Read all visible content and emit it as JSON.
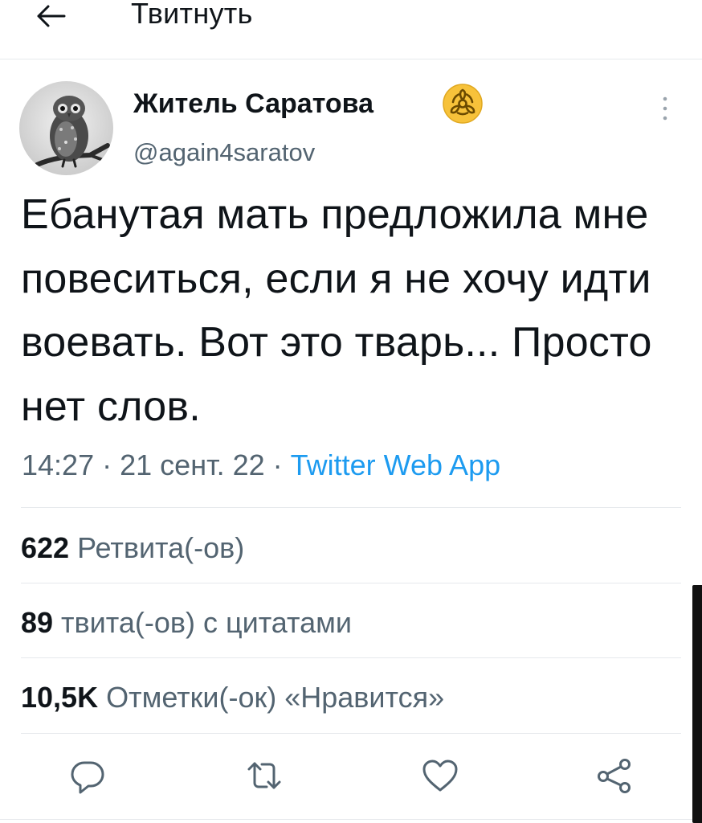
{
  "header": {
    "title": "Твитнуть",
    "back_icon": "arrow-left-icon"
  },
  "tweet": {
    "author": {
      "name": "Житель Саратова",
      "handle": "@again4saratov",
      "badge_icon": "biohazard-icon",
      "badge_color": "#f7c23a"
    },
    "text": "Ебанутая мать предложила мне повеситься, если я не хочу идти воевать. Вот это тварь... Просто нет слов.",
    "time": "14:27",
    "date": "21 сент. 22",
    "separator": "·",
    "source": "Twitter Web App"
  },
  "stats": [
    {
      "count": "622",
      "label": "Ретвита(-ов)"
    },
    {
      "count": "89",
      "label": "твита(-ов) с цитатами"
    },
    {
      "count": "10,5K",
      "label": "Отметки(-ок) «Нравится»"
    }
  ],
  "actions": [
    {
      "icon": "reply-icon"
    },
    {
      "icon": "retweet-icon"
    },
    {
      "icon": "like-icon"
    },
    {
      "icon": "share-icon"
    }
  ],
  "colors": {
    "text": "#0f1419",
    "secondary": "#536471",
    "link": "#1d9bf0",
    "divider": "#e6e9ec"
  }
}
